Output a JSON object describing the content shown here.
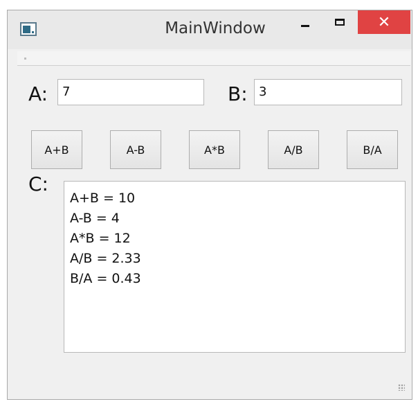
{
  "window": {
    "title": "MainWindow",
    "close_glyph": "✕"
  },
  "inputs": {
    "a_label": "A:",
    "a_value": "7",
    "b_label": "B:",
    "b_value": "3"
  },
  "buttons": [
    {
      "label": "A+B"
    },
    {
      "label": "A-B"
    },
    {
      "label": "A*B"
    },
    {
      "label": "A/B"
    },
    {
      "label": "B/A"
    }
  ],
  "output": {
    "label": "C:",
    "lines": [
      "A+B = 10",
      "A-B = 4",
      "A*B = 12",
      "A/B = 2.33",
      "B/A = 0.43"
    ]
  },
  "icons": {
    "app": "window-app-icon",
    "minimize": "minimize-icon",
    "maximize": "maximize-icon",
    "close": "close-icon",
    "resize": "resize-grip-icon"
  },
  "colors": {
    "close_button": "#e04343",
    "window_bg": "#f0f0f0",
    "input_bg": "#ffffff"
  }
}
